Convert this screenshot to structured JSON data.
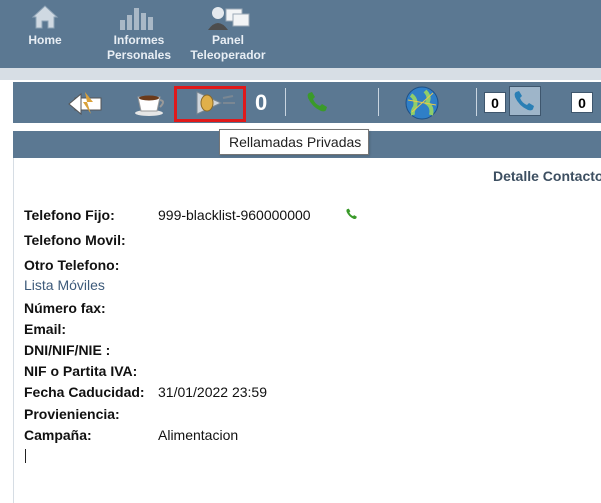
{
  "nav": {
    "items": [
      {
        "label_lines": [
          "Home"
        ],
        "icon": "home-icon"
      },
      {
        "label_lines": [
          "Informes",
          "Personales"
        ],
        "icon": "bar-chart-icon"
      },
      {
        "label_lines": [
          "Panel",
          "Teleoperador"
        ],
        "icon": "operator-icon"
      }
    ]
  },
  "toolbar": {
    "private_calls_count": "0",
    "counter_a": "0",
    "counter_b": "0",
    "tooltip": "Rellamadas Privadas",
    "icons": [
      "back-icon",
      "coffee-break-icon",
      "private-recall-icon",
      "phone-icon",
      "globe-icon",
      "phone-counter-icon"
    ]
  },
  "detail": {
    "title": "Detalle Contacto",
    "fields": {
      "telefono_fijo_label": "Telefono Fijo:",
      "telefono_fijo_value": "999-blacklist-960000000",
      "telefono_movil_label": "Telefono Movil:",
      "otro_telefono_label": "Otro Telefono:",
      "lista_moviles_link": "Lista Móviles",
      "numero_fax_label": "Número fax:",
      "email_label": "Email:",
      "dni_label": "DNI/NIF/NIE :",
      "nif_label": "NIF o Partita IVA:",
      "fecha_caducidad_label": "Fecha Caducidad:",
      "fecha_caducidad_value": "31/01/2022 23:59",
      "provieniencia_label": "Provieniencia:",
      "campana_label": "Campaña:",
      "campana_value": "Alimentacion"
    }
  },
  "colors": {
    "bar_blue": "#5b7892",
    "highlight_red": "#e0191a",
    "phone_green": "#3a9a2a"
  }
}
